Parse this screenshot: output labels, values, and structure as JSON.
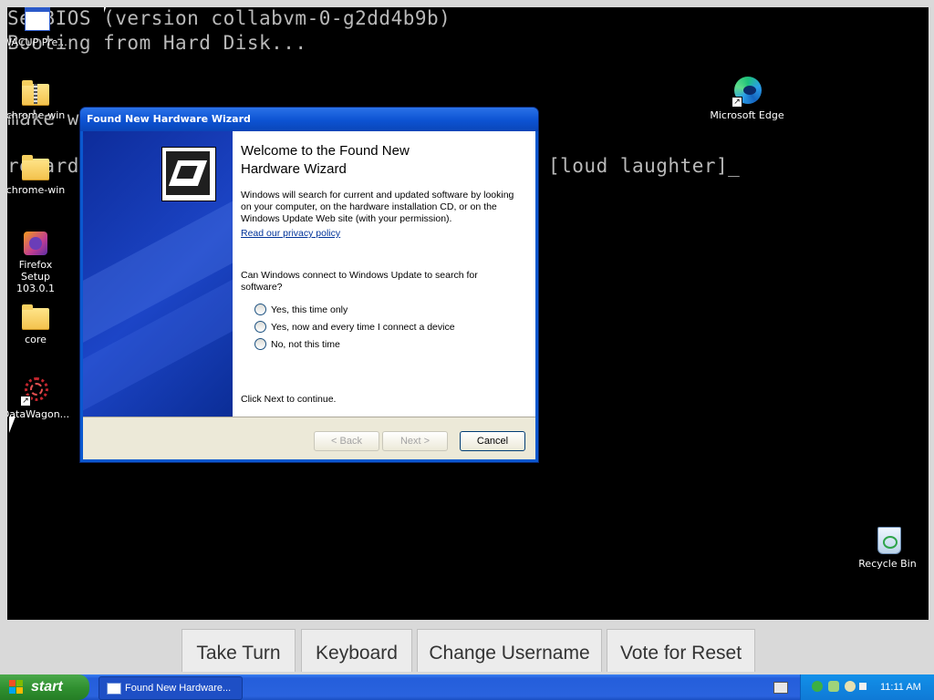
{
  "console": {
    "line1": "SeaBIOS (version collabvm-0-g2dd4b9b)",
    "line2": "Booting from Hard Disk...",
    "line3": "make w",
    "line4a": "retard",
    "line4b": "[loud laughter]_"
  },
  "desktop_icons": [
    {
      "label": "WACUP Pre...",
      "icon": "window-icon"
    },
    {
      "label": "chrome-win",
      "icon": "zip-folder-icon"
    },
    {
      "label": "chrome-win",
      "icon": "folder-icon"
    },
    {
      "label": "Firefox Setup 103.0.1",
      "icon": "installer-icon"
    },
    {
      "label": "core",
      "icon": "folder-icon"
    },
    {
      "label": "DataWagon...",
      "icon": "app-shortcut-icon"
    },
    {
      "label": "Microsoft Edge",
      "icon": "edge-icon"
    },
    {
      "label": "Recycle Bin",
      "icon": "recycle-bin-icon"
    }
  ],
  "wizard": {
    "title": "Found New Hardware Wizard",
    "heading": "Welcome to the Found New Hardware Wizard",
    "intro": "Windows will search for current and updated software by looking on your computer, on the hardware installation CD, or on the Windows Update Web site (with your permission).",
    "privacy_link": "Read our privacy policy",
    "question": "Can Windows connect to Windows Update to search for software?",
    "options": [
      "Yes, this time only",
      "Yes, now and every time I connect a device",
      "No, not this time"
    ],
    "continue": "Click Next to continue.",
    "back_label": "< Back",
    "next_label": "Next >",
    "cancel_label": "Cancel"
  },
  "actions": {
    "take_turn": "Take Turn",
    "keyboard": "Keyboard",
    "change_username": "Change Username",
    "vote_reset": "Vote for Reset"
  },
  "taskbar": {
    "start_label": "start",
    "task_label": "Found New Hardware...",
    "clock": "11:11 AM"
  },
  "colors": {
    "desktop": "#000000",
    "titlebar": "#0c52d2",
    "start": "#2f8f2f",
    "taskbar": "#245edb"
  }
}
